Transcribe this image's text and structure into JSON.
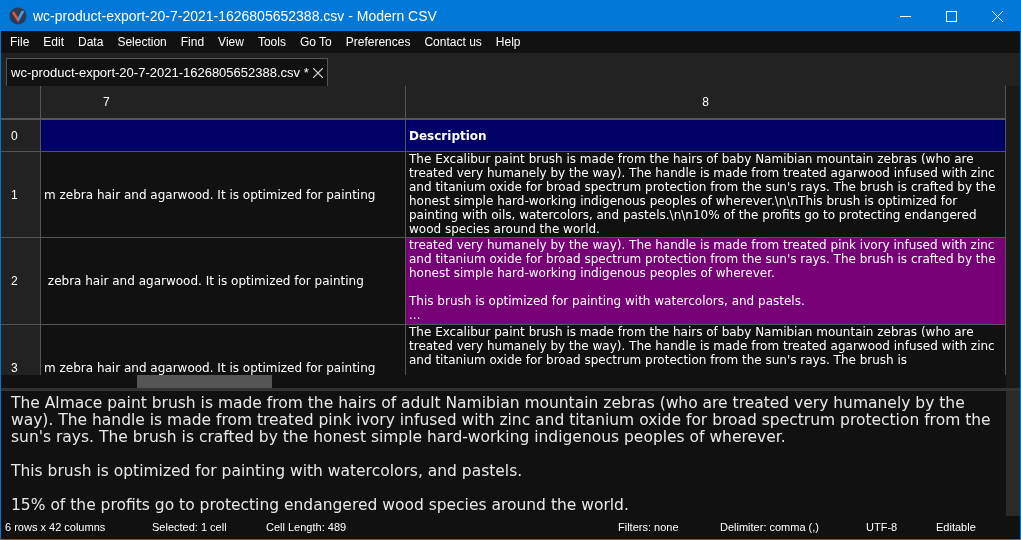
{
  "window": {
    "title": "wc-product-export-20-7-2021-1626805652388.csv - Modern CSV"
  },
  "menu": [
    "File",
    "Edit",
    "Data",
    "Selection",
    "Find",
    "View",
    "Tools",
    "Go To",
    "Preferences",
    "Contact us",
    "Help"
  ],
  "tabs": [
    {
      "label": "wc-product-export-20-7-2021-1626805652388.csv *",
      "selected": true
    }
  ],
  "table": {
    "columns": [
      "7",
      "8"
    ],
    "rows": [
      {
        "header": "0",
        "cells": [
          "",
          "Description"
        ],
        "kind": "header_row",
        "selected": false
      },
      {
        "header": "1",
        "cells": [
          "m zebra hair and agarwood. It is optimized for painting",
          "The Excalibur paint brush is made from the hairs of baby Namibian mountain zebras (who are treated very humanely by the way). The handle is made from treated agarwood infused with zinc and titanium oxide for broad spectrum protection from the sun's rays. The brush is crafted by the honest simple hard-working indigenous peoples of wherever.\\n\\nThis brush is optimized for painting with oils, watercolors, and pastels.\\n\\n10% of the profits go to protecting endangered wood species around the world."
        ],
        "kind": "data",
        "selected": false
      },
      {
        "header": "2",
        "cells": [
          " zebra hair and agarwood. It is optimized for painting",
          "treated very humanely by the way). The handle is made from treated pink ivory infused with zinc and titanium oxide for broad spectrum protection from the sun's rays. The brush is crafted by the honest simple hard-working indigenous peoples of wherever.\n\nThis brush is optimized for painting with watercolors, and pastels.\n..."
        ],
        "kind": "data",
        "selected": true
      },
      {
        "header": "3",
        "cells": [
          "m zebra hair and agarwood. It is optimized for painting",
          "The Excalibur paint brush is made from the hairs of baby Namibian mountain zebras (who are treated very humanely by the way). The handle is made from treated agarwood infused with zinc and titanium oxide for broad spectrum protection from the sun's rays. The brush is"
        ],
        "kind": "data",
        "selected": false
      }
    ]
  },
  "editor": {
    "value": "The Almace paint brush is made from the hairs of adult Namibian mountain zebras (who are treated very humanely by the way). The handle is made from treated pink ivory infused with zinc and titanium oxide for broad spectrum protection from the sun's rays. The brush is crafted by the honest simple hard-working indigenous peoples of wherever.\n\nThis brush is optimized for painting with watercolors, and pastels.\n\n15% of the profits go to protecting endangered wood species around the world."
  },
  "status_bar": {
    "left": [
      "6 rows x 42 columns",
      "Selected: 1 cell",
      "Cell Length: 489"
    ],
    "right": [
      "Filters: none",
      "Delimiter: comma (,)",
      "UTF-8",
      "Editable"
    ]
  }
}
